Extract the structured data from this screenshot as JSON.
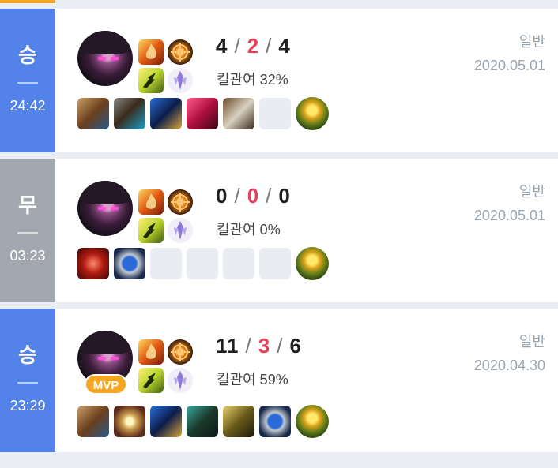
{
  "matches": [
    {
      "result": "승",
      "duration": "24:42",
      "kills": "4",
      "deaths": "2",
      "assists": "4",
      "kill_participation": "킬관여 32%",
      "mode": "일반",
      "date": "2020.05.01",
      "mvp": "",
      "result_color": "#5383e8",
      "items": [
        "item-icon",
        "item-icon",
        "item-icon",
        "item-icon",
        "item-icon",
        "empty",
        "trinket"
      ]
    },
    {
      "result": "무",
      "duration": "03:23",
      "kills": "0",
      "deaths": "0",
      "assists": "0",
      "kill_participation": "킬관여 0%",
      "mode": "일반",
      "date": "2020.05.01",
      "mvp": "",
      "result_color": "#a3a8b0",
      "items": [
        "item-icon",
        "item-icon",
        "empty",
        "empty",
        "empty",
        "empty",
        "trinket"
      ]
    },
    {
      "result": "승",
      "duration": "23:29",
      "kills": "11",
      "deaths": "3",
      "assists": "6",
      "kill_participation": "킬관여 59%",
      "mode": "일반",
      "date": "2020.04.30",
      "mvp": "MVP",
      "result_color": "#5383e8",
      "items": [
        "item-icon",
        "item-icon",
        "item-icon",
        "item-icon",
        "item-icon",
        "item-icon",
        "trinket"
      ]
    }
  ],
  "colors": {
    "win": "#5383e8",
    "draw": "#a3a8b0",
    "death": "#e84057",
    "mvp": "#f5a623"
  }
}
